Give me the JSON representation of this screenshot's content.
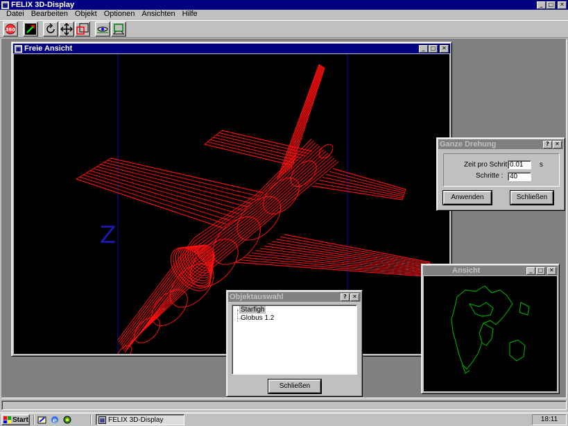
{
  "app": {
    "title": "FELIX 3D-Display"
  },
  "menubar": {
    "items": [
      {
        "label": "Datei"
      },
      {
        "label": "Bearbeiten"
      },
      {
        "label": "Objekt"
      },
      {
        "label": "Optionen"
      },
      {
        "label": "Ansichten"
      },
      {
        "label": "Hilfe"
      }
    ]
  },
  "toolbar": {
    "icons": [
      "view-360-icon",
      "scale-icon",
      "rotate-icon",
      "move-icon",
      "zoom-box-icon",
      "camera-icon",
      "fit-view-icon"
    ]
  },
  "freie_ansicht": {
    "title": "Freie Ansicht",
    "axis_label": "Z",
    "wire_color": "#ff0000"
  },
  "second_view": {
    "title": "Ansicht",
    "wire_color": "#00c000"
  },
  "ganze_drehung": {
    "title": "Ganze Drehung",
    "zeit_label": "Zeit pro Schritt :",
    "zeit_value": "0.01",
    "zeit_unit": "s",
    "schritte_label": "Schritte :",
    "schritte_value": "40",
    "apply_label": "Anwenden",
    "close_label": "Schließen"
  },
  "objektauswahl": {
    "title": "Objektauswahl",
    "items": [
      {
        "label": "Starfigh",
        "selected": true
      },
      {
        "label": "Globus 1.2",
        "selected": false
      }
    ],
    "close_label": "Schließen"
  },
  "taskbar": {
    "start_label": "Start",
    "task_label": "FELIX 3D-Display",
    "clock": "18:11"
  },
  "colors": {
    "title_active": "#000080",
    "title_inactive": "#808080",
    "face": "#c0c0c0"
  }
}
